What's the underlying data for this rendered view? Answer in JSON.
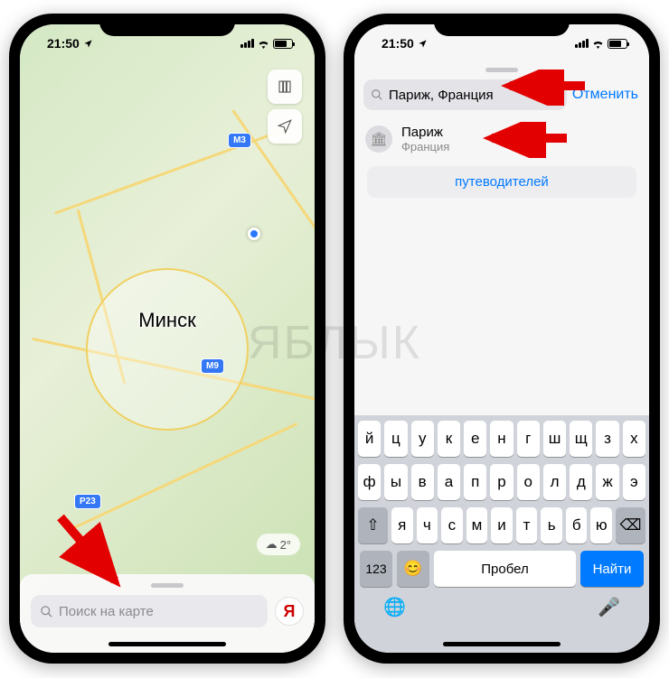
{
  "status": {
    "time": "21:50",
    "location_icon": true
  },
  "left": {
    "city_label": "Минск",
    "routes": {
      "m3": "M3",
      "m9": "M9",
      "p23": "P23"
    },
    "weather": "2°",
    "search_placeholder": "Поиск на карте",
    "account_initial": "Я"
  },
  "right": {
    "search_value": "Париж, Франция",
    "cancel": "Отменить",
    "result": {
      "title": "Париж",
      "subtitle": "Франция"
    },
    "guides_button": "путеводителей",
    "keyboard": {
      "row1": [
        "й",
        "ц",
        "у",
        "к",
        "е",
        "н",
        "г",
        "ш",
        "щ",
        "з",
        "х"
      ],
      "row2": [
        "ф",
        "ы",
        "в",
        "а",
        "п",
        "р",
        "о",
        "л",
        "д",
        "ж",
        "э"
      ],
      "row3": [
        "я",
        "ч",
        "с",
        "м",
        "и",
        "т",
        "ь",
        "б",
        "ю"
      ],
      "shift": "⇧",
      "backspace": "⌫",
      "numeric": "123",
      "emoji": "😊",
      "space": "Пробел",
      "search": "Найти",
      "globe": "🌐",
      "mic": "🎤"
    }
  },
  "watermark": "ЯБЛЫК"
}
